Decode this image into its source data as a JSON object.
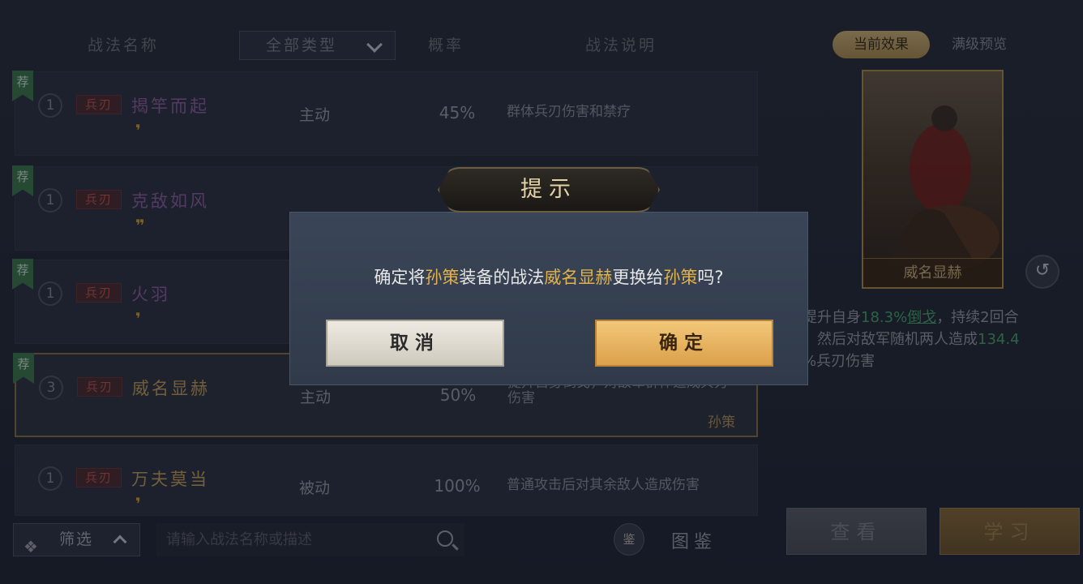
{
  "header": {
    "col_name": "战法名称",
    "type_filter": "全部类型",
    "col_rate": "概率",
    "col_desc": "战法说明"
  },
  "rows": [
    {
      "tag": "荐",
      "level": "1",
      "kind": "兵刃",
      "name": "揭竿而起",
      "quotes": "❜",
      "type": "主动",
      "rate": "45%",
      "desc": "群体兵刃伤害和禁疗",
      "owner": ""
    },
    {
      "tag": "荐",
      "level": "1",
      "kind": "兵刃",
      "name": "克敌如风",
      "quotes": "❜❜",
      "type": "",
      "rate": "",
      "desc": "",
      "owner": ""
    },
    {
      "tag": "荐",
      "level": "1",
      "kind": "兵刃",
      "name": "火羽",
      "quotes": "❜",
      "type": "",
      "rate": "",
      "desc": "",
      "owner": ""
    },
    {
      "tag": "荐",
      "level": "3",
      "kind": "兵刃",
      "name": "威名显赫",
      "quotes": "",
      "type": "主动",
      "rate": "50%",
      "desc": "提升自身倒戈，对敌军群体造成兵刃伤害",
      "owner": "孙策"
    },
    {
      "tag": "",
      "level": "1",
      "kind": "兵刃",
      "name": "万夫莫当",
      "quotes": "❜",
      "type": "被动",
      "rate": "100%",
      "desc": "普通攻击后对其余敌人造成伤害",
      "owner": ""
    }
  ],
  "bottom": {
    "filter_label": "筛选",
    "search_placeholder": "请输入战法名称或描述",
    "atlas_label": "图鉴",
    "atlas_icon": "鉴"
  },
  "right": {
    "tab_current": "当前效果",
    "tab_max": "满级预览",
    "card_name": "威名显赫",
    "effect_a": "提升自身",
    "effect_b": "18.3%",
    "effect_c": "倒戈",
    "effect_d": "，持续2回合",
    "effect_e": "。然后对敌军随机两人造成",
    "effect_f": "134.4",
    "effect_g": "%兵刃伤害",
    "btn_view": "查看",
    "btn_learn": "学习"
  },
  "dialog": {
    "title": "提示",
    "msg_1": "确定将",
    "msg_2": "孙策",
    "msg_3": "装备的战法",
    "msg_4": "威名显赫",
    "msg_5": "更换给",
    "msg_6": "孙策",
    "msg_7": "吗?",
    "cancel": "取消",
    "ok": "确定"
  },
  "icons": {
    "filter": "filter-icon",
    "search": "search-icon",
    "atlas": "atlas-icon",
    "refresh": "refresh-icon",
    "chevron": "chevron-down-icon"
  },
  "colors": {
    "accent_gold": "#e3b24b",
    "recommend_green": "#3d7a4e",
    "kind_red": "#c7544d",
    "effect_green": "#4aa86a"
  }
}
